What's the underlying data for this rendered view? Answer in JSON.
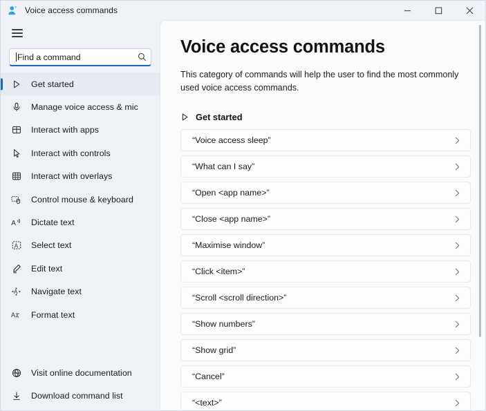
{
  "window": {
    "title": "Voice access commands",
    "app_icon": "voice-access-person-icon",
    "controls": {
      "minimize": "minimize-icon",
      "maximize": "maximize-icon",
      "close": "close-icon"
    }
  },
  "sidebar": {
    "menu_button": "hamburger-menu-icon",
    "search": {
      "placeholder": "Find a command",
      "value": "",
      "icon": "search-icon"
    },
    "items": [
      {
        "label": "Get started",
        "icon": "play-triangle-icon",
        "selected": true
      },
      {
        "label": "Manage voice access & mic",
        "icon": "microphone-icon",
        "selected": false
      },
      {
        "label": "Interact with apps",
        "icon": "apps-grid-icon",
        "selected": false
      },
      {
        "label": "Interact with controls",
        "icon": "cursor-arrow-icon",
        "selected": false
      },
      {
        "label": "Interact with overlays",
        "icon": "overlay-grid-icon",
        "selected": false
      },
      {
        "label": "Control mouse & keyboard",
        "icon": "mouse-keyboard-icon",
        "selected": false
      },
      {
        "label": "Dictate text",
        "icon": "dictate-a-icon",
        "selected": false
      },
      {
        "label": "Select text",
        "icon": "select-text-icon",
        "selected": false
      },
      {
        "label": "Edit text",
        "icon": "edit-pencil-icon",
        "selected": false
      },
      {
        "label": "Navigate text",
        "icon": "navigate-text-icon",
        "selected": false
      },
      {
        "label": "Format text",
        "icon": "format-text-icon",
        "selected": false
      }
    ],
    "bottom_items": [
      {
        "label": "Visit online documentation",
        "icon": "globe-icon"
      },
      {
        "label": "Download command list",
        "icon": "download-icon"
      }
    ]
  },
  "main": {
    "title": "Voice access commands",
    "description": "This category of commands will help the user to find the most commonly used voice access commands.",
    "section": {
      "icon": "play-triangle-icon",
      "title": "Get started"
    },
    "commands": [
      {
        "text": "“Voice access sleep”",
        "chevron": "chevron-right-icon"
      },
      {
        "text": "“What can I say”",
        "chevron": "chevron-right-icon"
      },
      {
        "text": "“Open <app name>”",
        "chevron": "chevron-right-icon"
      },
      {
        "text": "“Close <app name>”",
        "chevron": "chevron-right-icon"
      },
      {
        "text": "“Maximise window”",
        "chevron": "chevron-right-icon"
      },
      {
        "text": "“Click <item>”",
        "chevron": "chevron-right-icon"
      },
      {
        "text": "“Scroll <scroll direction>”",
        "chevron": "chevron-right-icon"
      },
      {
        "text": "“Show numbers”",
        "chevron": "chevron-right-icon"
      },
      {
        "text": "“Show grid”",
        "chevron": "chevron-right-icon"
      },
      {
        "text": "“Cancel”",
        "chevron": "chevron-right-icon"
      },
      {
        "text": "“<text>”",
        "chevron": "chevron-right-icon"
      }
    ]
  },
  "colors": {
    "accent": "#1766c0",
    "sidebar_bg": "#eef1f6",
    "content_bg": "#fafbfd",
    "card_bg": "#fdfdfe"
  }
}
